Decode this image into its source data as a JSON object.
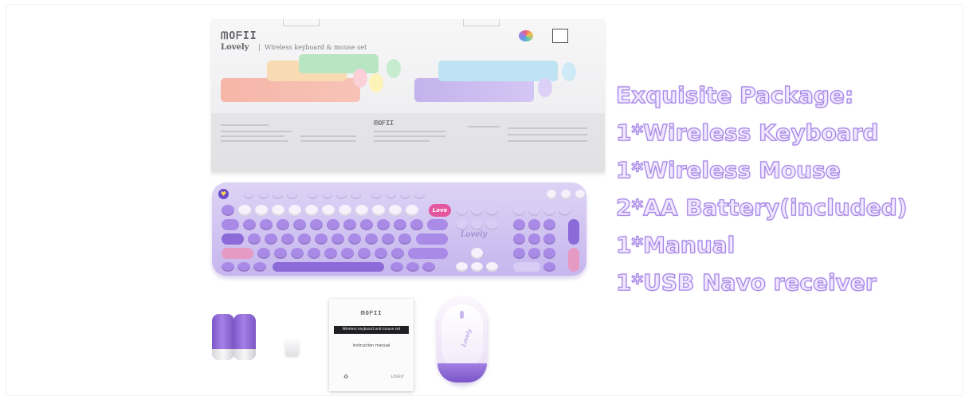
{
  "package_box": {
    "brand": "ᗰOᖴII",
    "model": "Lovely",
    "subtitle": "Wireless keyboard & mouse set",
    "bottom_brand": "ᗰOᖴII"
  },
  "keyboard": {
    "badge": "Love",
    "signature": "Lovely"
  },
  "manual": {
    "brand": "ᗰOᖴII",
    "title_bar": "Wireless keyboard and mouse set",
    "subtitle": "Instruction manual",
    "footer_brand": "LOVELY"
  },
  "mouse": {
    "script": "Lovely"
  },
  "package_list": {
    "heading": "Exquisite Package:",
    "items": [
      "1*Wireless Keyboard",
      "1*Wireless Mouse",
      "2*AA Battery(included)",
      "1*Manual",
      "1*USB Navo receiver"
    ]
  },
  "colors": {
    "lavender": "#b89cf0",
    "purple": "#8c6ad8",
    "box_grey": "#e4e4e7",
    "text_fill": "#f1e8ff",
    "text_stroke": "#a585e6"
  }
}
